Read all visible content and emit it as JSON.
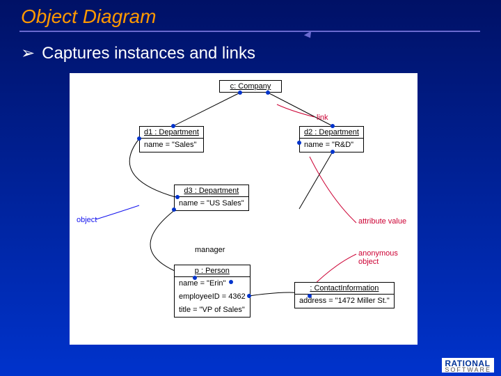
{
  "slide": {
    "title": "Object Diagram",
    "bullet": "Captures instances and links"
  },
  "objects": {
    "company": {
      "header": "c: Company"
    },
    "dept1": {
      "header": "d1 : Department",
      "attr": "name = \"Sales\""
    },
    "dept2": {
      "header": "d2 : Department",
      "attr": "name = \"R&D\""
    },
    "dept3": {
      "header": "d3 : Department",
      "attr": "name = \"US Sales\""
    },
    "person": {
      "header": "p : Person",
      "attrs": [
        "name = \"Erin\"",
        "employeeID = 4362",
        "title = \"VP of Sales\""
      ]
    },
    "contact": {
      "header": "  : ContactInformation",
      "attr": "address = \"1472 Miller St.\""
    }
  },
  "labels": {
    "link": "link",
    "object": "object",
    "manager": "manager",
    "attribute_value": "attribute value",
    "anonymous_object": "anonymous object"
  },
  "branding": {
    "name": "RATIONAL",
    "sub": "SOFTWARE"
  }
}
